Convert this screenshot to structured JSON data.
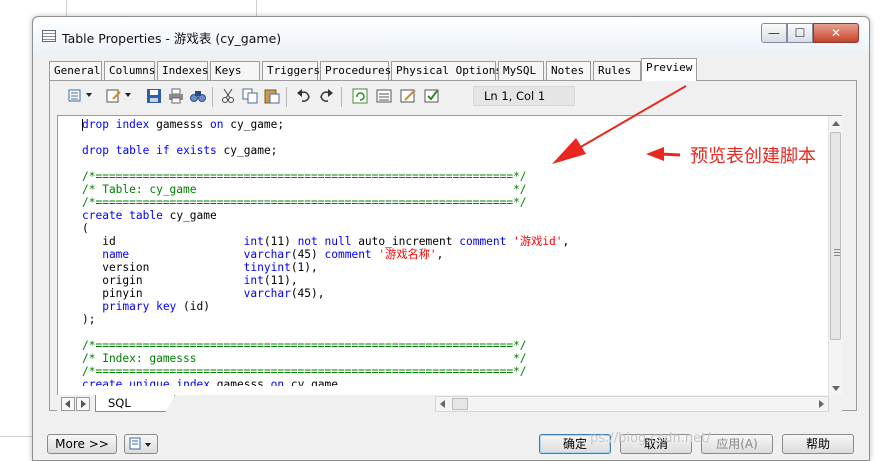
{
  "window": {
    "title": "Table Properties - 游戏表 (cy_game)",
    "minimize": "—",
    "maximize": "☐",
    "close": "✕"
  },
  "tabs": [
    "General",
    "Columns",
    "Indexes",
    "Keys",
    "Triggers",
    "Procedures",
    "Physical Options",
    "MySQL",
    "Notes",
    "Rules",
    "Preview"
  ],
  "active_tab": "Preview",
  "toolbar": {
    "icons": [
      "properties-icon",
      "edit-icon",
      "save-icon",
      "print-icon",
      "find-icon",
      "cut-icon",
      "copy-icon",
      "paste-icon",
      "undo-icon",
      "redo-icon",
      "refresh-icon",
      "list-icon",
      "edit-script-icon",
      "check-icon"
    ],
    "position": "Ln 1, Col 1"
  },
  "code_lines": [
    [
      [
        "k",
        "drop"
      ],
      [
        "t",
        " "
      ],
      [
        "k",
        "index"
      ],
      [
        "t",
        " gamesss "
      ],
      [
        "k",
        "on"
      ],
      [
        "t",
        " cy_game;"
      ]
    ],
    [],
    [
      [
        "k",
        "drop"
      ],
      [
        "t",
        " "
      ],
      [
        "k",
        "table"
      ],
      [
        "t",
        " "
      ],
      [
        "k",
        "if"
      ],
      [
        "t",
        " "
      ],
      [
        "k",
        "exists"
      ],
      [
        "t",
        " cy_game;"
      ]
    ],
    [],
    [
      [
        "c",
        "/*==============================================================*/"
      ]
    ],
    [
      [
        "c",
        "/* Table: cy_game                                               */"
      ]
    ],
    [
      [
        "c",
        "/*==============================================================*/"
      ]
    ],
    [
      [
        "k",
        "create"
      ],
      [
        "t",
        " "
      ],
      [
        "k",
        "table"
      ],
      [
        "t",
        " cy_game"
      ]
    ],
    [
      [
        "t",
        "("
      ]
    ],
    [
      [
        "t",
        "   id                   "
      ],
      [
        "k",
        "int"
      ],
      [
        "t",
        "(11) "
      ],
      [
        "k",
        "not null"
      ],
      [
        "t",
        " auto_increment "
      ],
      [
        "k",
        "comment"
      ],
      [
        "t",
        " "
      ],
      [
        "s",
        "'游戏id'"
      ],
      [
        "t",
        ","
      ]
    ],
    [
      [
        "k",
        "   name"
      ],
      [
        "t",
        "                 "
      ],
      [
        "k",
        "varchar"
      ],
      [
        "t",
        "(45) "
      ],
      [
        "k",
        "comment"
      ],
      [
        "t",
        " "
      ],
      [
        "s",
        "'游戏名称'"
      ],
      [
        "t",
        ","
      ]
    ],
    [
      [
        "t",
        "   version              "
      ],
      [
        "k",
        "tinyint"
      ],
      [
        "t",
        "(1),"
      ]
    ],
    [
      [
        "t",
        "   origin               "
      ],
      [
        "k",
        "int"
      ],
      [
        "t",
        "(11),"
      ]
    ],
    [
      [
        "t",
        "   pinyin               "
      ],
      [
        "k",
        "varchar"
      ],
      [
        "t",
        "(45),"
      ]
    ],
    [
      [
        "k",
        "   primary key"
      ],
      [
        "t",
        " (id)"
      ]
    ],
    [
      [
        "t",
        ");"
      ]
    ],
    [],
    [
      [
        "c",
        "/*==============================================================*/"
      ]
    ],
    [
      [
        "c",
        "/* Index: gamesss                                               */"
      ]
    ],
    [
      [
        "c",
        "/*==============================================================*/"
      ]
    ],
    [
      [
        "k",
        "create"
      ],
      [
        "t",
        " "
      ],
      [
        "k",
        "unique"
      ],
      [
        "t",
        " "
      ],
      [
        "k",
        "index"
      ],
      [
        "t",
        " gamesss "
      ],
      [
        "k",
        "on"
      ],
      [
        "t",
        " cy_game"
      ]
    ]
  ],
  "bottom_tab": "SQL",
  "buttons": {
    "more": "More >>",
    "ok": "确定",
    "cancel": "取消",
    "apply": "应用(A)",
    "help": "帮助"
  },
  "annotation": "预览表创建脚本",
  "watermark": "ps://blog.csdn.net/"
}
